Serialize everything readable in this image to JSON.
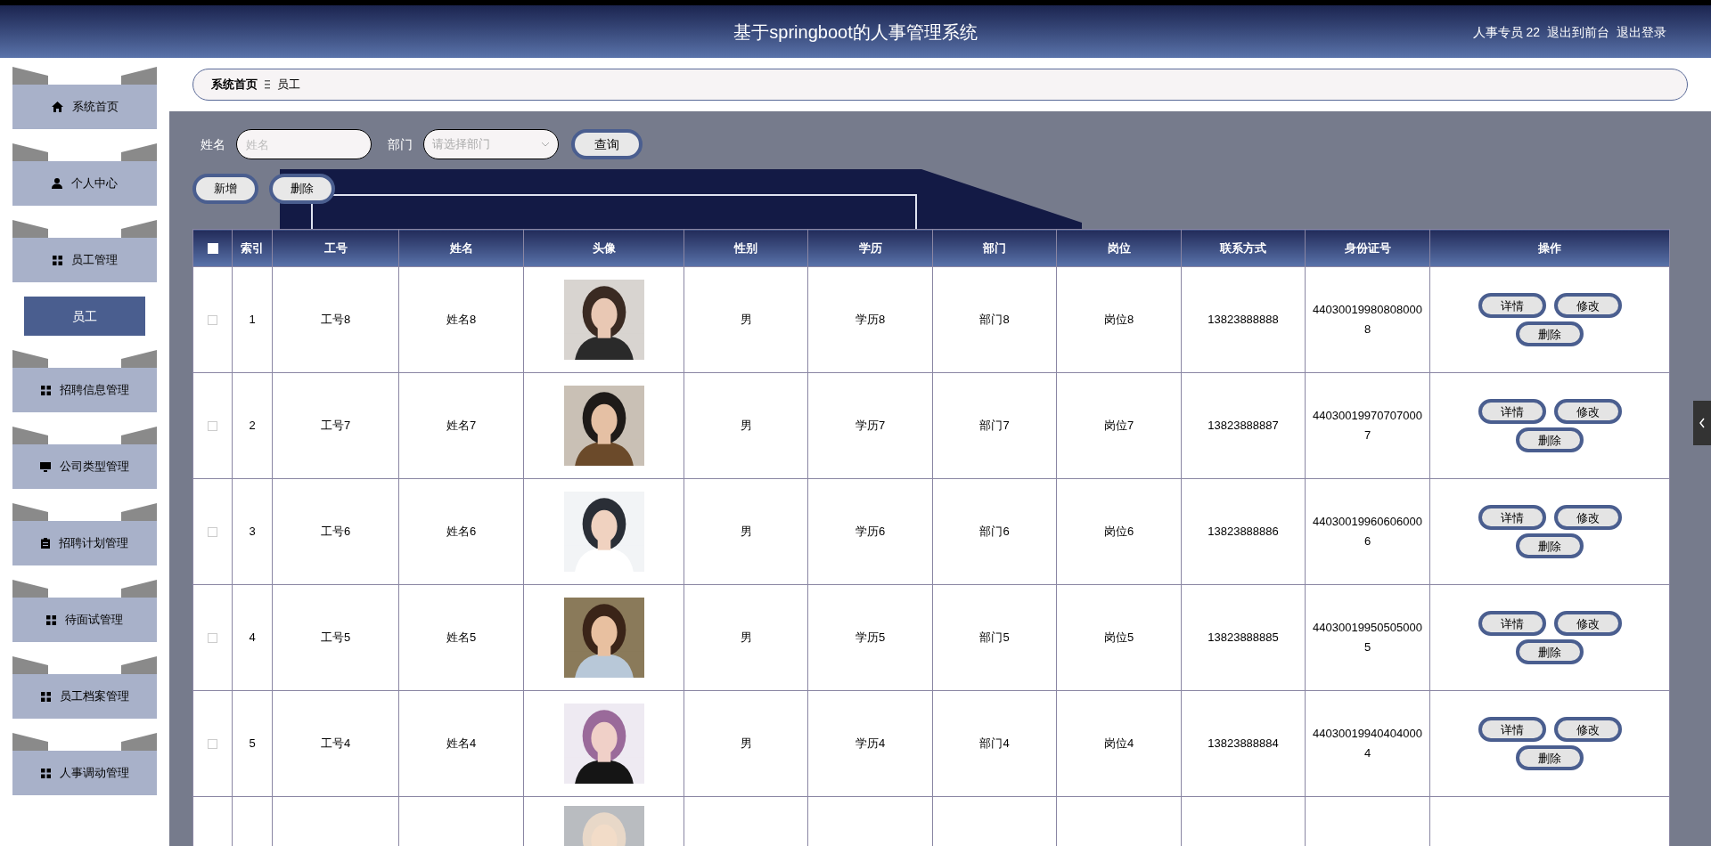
{
  "header": {
    "title": "基于springboot的人事管理系统",
    "user": "人事专员 22",
    "links": [
      "退出到前台",
      "退出登录"
    ]
  },
  "sidebar": {
    "items": [
      {
        "label": "系统首页",
        "kind": "home"
      },
      {
        "label": "个人中心",
        "kind": "user"
      },
      {
        "label": "员工管理",
        "kind": "grid",
        "children": [
          {
            "label": "员工",
            "selected": true
          }
        ]
      },
      {
        "label": "招聘信息管理",
        "kind": "grid"
      },
      {
        "label": "公司类型管理",
        "kind": "monitor"
      },
      {
        "label": "招聘计划管理",
        "kind": "clipboard"
      },
      {
        "label": "待面试管理",
        "kind": "grid"
      },
      {
        "label": "员工档案管理",
        "kind": "grid"
      },
      {
        "label": "人事调动管理",
        "kind": "grid"
      }
    ]
  },
  "breadcrumb": [
    "系统首页",
    "员工"
  ],
  "search": {
    "fields": [
      {
        "label": "姓名",
        "kind": "text",
        "placeholder": "姓名"
      },
      {
        "label": "部门",
        "kind": "select",
        "placeholder": "请选择部门"
      }
    ],
    "button": "查询"
  },
  "actions": [
    "新增",
    "删除"
  ],
  "table": {
    "select_all": {
      "checked": false
    },
    "columns": [
      "索引",
      "工号",
      "姓名",
      "头像",
      "性别",
      "学历",
      "部门",
      "岗位",
      "联系方式",
      "身份证号",
      "操作"
    ],
    "rows": [
      {
        "checked": false,
        "cells": [
          "1",
          "工号8",
          "姓名8",
          {
            "kind": "picture"
          },
          "男",
          "学历8",
          "部门8",
          "岗位8",
          "13823888888",
          "440300199808080008"
        ],
        "actions": [
          "详情",
          "修改",
          "删除"
        ]
      },
      {
        "checked": false,
        "cells": [
          "2",
          "工号7",
          "姓名7",
          {
            "kind": "picture"
          },
          "男",
          "学历7",
          "部门7",
          "岗位7",
          "13823888887",
          "440300199707070007"
        ],
        "actions": [
          "详情",
          "修改",
          "删除"
        ]
      },
      {
        "checked": false,
        "cells": [
          "3",
          "工号6",
          "姓名6",
          {
            "kind": "picture"
          },
          "男",
          "学历6",
          "部门6",
          "岗位6",
          "13823888886",
          "440300199606060006"
        ],
        "actions": [
          "详情",
          "修改",
          "删除"
        ]
      },
      {
        "checked": false,
        "cells": [
          "4",
          "工号5",
          "姓名5",
          {
            "kind": "picture"
          },
          "男",
          "学历5",
          "部门5",
          "岗位5",
          "13823888885",
          "440300199505050005"
        ],
        "actions": [
          "详情",
          "修改",
          "删除"
        ]
      },
      {
        "checked": false,
        "cells": [
          "5",
          "工号4",
          "姓名4",
          {
            "kind": "picture"
          },
          "男",
          "学历4",
          "部门4",
          "岗位4",
          "13823888884",
          "440300199404040004"
        ],
        "actions": [
          "详情",
          "修改",
          "删除"
        ]
      }
    ]
  }
}
